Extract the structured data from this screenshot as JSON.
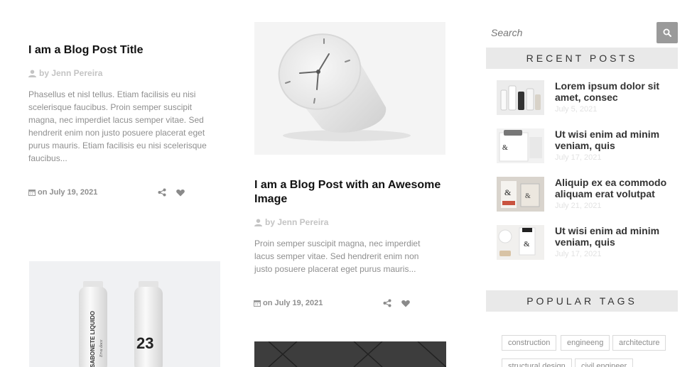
{
  "posts": [
    {
      "title": "I am a Blog Post Title",
      "author": "by Jenn Pereira",
      "excerpt": "Phasellus et nisl tellus. Etiam facilisis eu nisi scelerisque faucibus. Proin semper suscipit magna, nec imperdiet lacus semper vitae. Sed hendrerit enim non justo posuere placerat eget purus mauris. Etiam facilisis eu nisi scelerisque faucibus...",
      "date": "on July 19, 2021"
    },
    {
      "title": "I am a Blog Post with an Awesome Image",
      "author": "by Jenn Pereira",
      "excerpt": "Proin semper suscipit magna, nec imperdiet lacus semper vitae. Sed hendrerit enim non justo posuere placerat eget purus mauris...",
      "date": "on July 19, 2021"
    }
  ],
  "bottle_image": {
    "label": "SABONETE LIQUIDO",
    "sub": "Erva doce",
    "number": "23"
  },
  "search": {
    "placeholder": "Search"
  },
  "recent_posts": {
    "heading": "RECENT POSTS",
    "items": [
      {
        "title": "Lorem ipsum dolor sit amet, consec",
        "date": "July 5, 2021"
      },
      {
        "title": "Ut wisi enim ad minim veniam, quis",
        "date": "July 17, 2021"
      },
      {
        "title": "Aliquip ex ea commodo aliquam erat volutpat",
        "date": "July 21, 2021"
      },
      {
        "title": "Ut wisi enim ad minim veniam, quis",
        "date": "July 17, 2021"
      }
    ]
  },
  "popular_tags": {
    "heading": "POPULAR TAGS",
    "tags": [
      "construction",
      "engineeng",
      "architecture",
      "structural design",
      "civil engineer"
    ]
  },
  "colors": {
    "accent_gray": "#9a9a9a",
    "widget_bg": "#e9e9e9",
    "muted_text": "#8f8f8f"
  }
}
